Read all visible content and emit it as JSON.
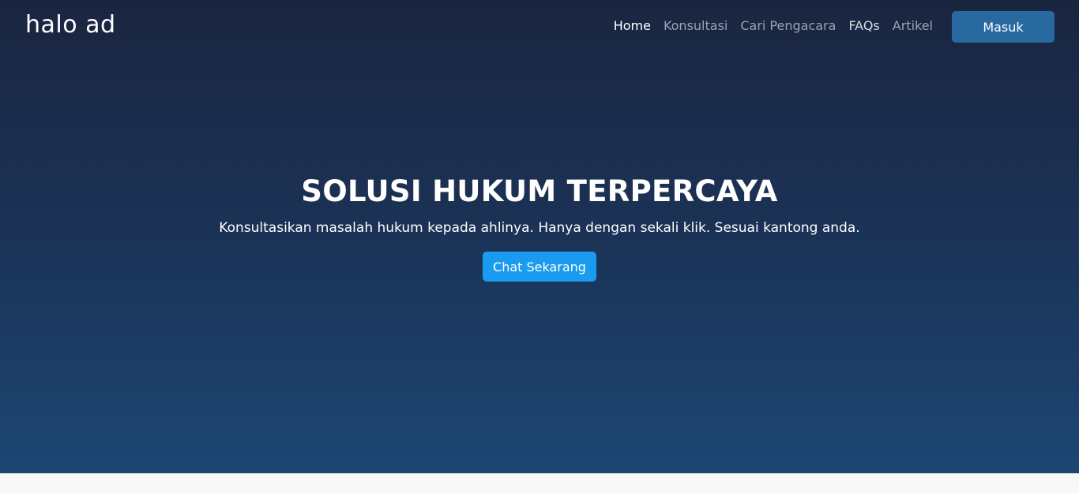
{
  "header": {
    "logo_text": "halo ad",
    "nav": [
      {
        "label": "Home",
        "state": "active"
      },
      {
        "label": "Konsultasi",
        "state": "muted"
      },
      {
        "label": "Cari Pengacara",
        "state": "muted"
      },
      {
        "label": "FAQs",
        "state": "light"
      },
      {
        "label": "Artikel",
        "state": "muted"
      }
    ],
    "login_label": "Masuk"
  },
  "hero": {
    "title": "SOLUSI HUKUM TERPERCAYA",
    "subtitle": "Konsultasikan masalah hukum kepada ahlinya. Hanya dengan sekali klik. Sesuai kantong anda.",
    "cta_label": "Chat Sekarang"
  },
  "colors": {
    "hero_gradient_top": "#1a2540",
    "hero_gradient_bottom": "#1c4673",
    "login_button": "#286aa0",
    "cta_button": "#1a9bf0",
    "page_background": "#f8f8f8"
  }
}
